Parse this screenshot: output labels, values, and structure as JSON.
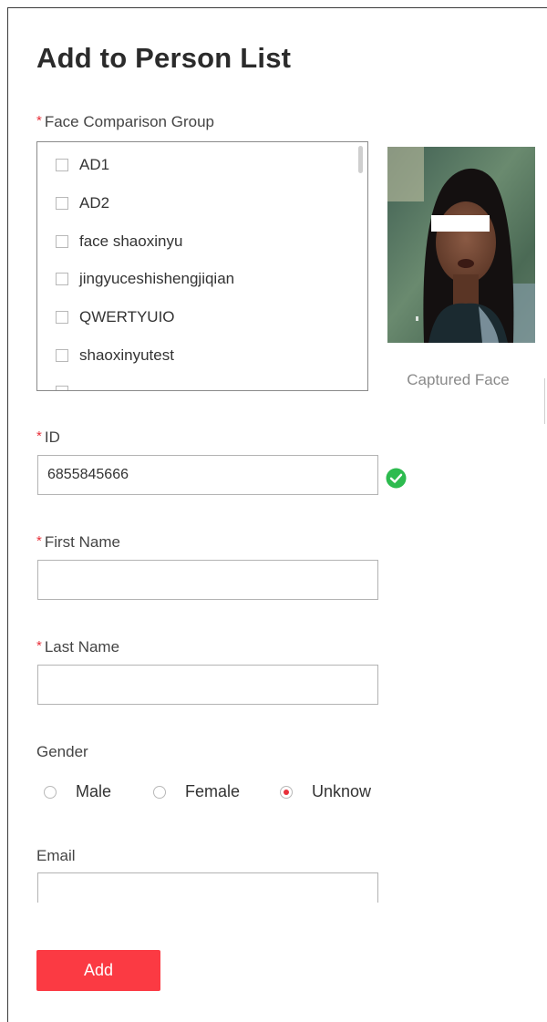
{
  "page": {
    "title": "Add to Person List"
  },
  "required_marker": "*",
  "face_group": {
    "label": "Face Comparison Group",
    "items": [
      {
        "label": "AD1",
        "checked": false
      },
      {
        "label": "AD2",
        "checked": false
      },
      {
        "label": "face shaoxinyu",
        "checked": false
      },
      {
        "label": "jingyuceshishengjiqian",
        "checked": false
      },
      {
        "label": "QWERTYUIO",
        "checked": false
      },
      {
        "label": "shaoxinyutest",
        "checked": false
      },
      {
        "label": "",
        "checked": false
      }
    ]
  },
  "captured_face": {
    "caption": "Captured Face"
  },
  "id_field": {
    "label": "ID",
    "value": "6855845666",
    "valid": true
  },
  "first_name": {
    "label": "First Name",
    "value": ""
  },
  "last_name": {
    "label": "Last Name",
    "value": ""
  },
  "gender": {
    "label": "Gender",
    "options": [
      {
        "label": "Male",
        "checked": false
      },
      {
        "label": "Female",
        "checked": false
      },
      {
        "label": "Unknow",
        "checked": true
      }
    ]
  },
  "email": {
    "label": "Email",
    "value": ""
  },
  "actions": {
    "add_label": "Add"
  },
  "colors": {
    "accent": "#fb3a43",
    "required": "#e8303a",
    "valid": "#2dbb4f"
  }
}
